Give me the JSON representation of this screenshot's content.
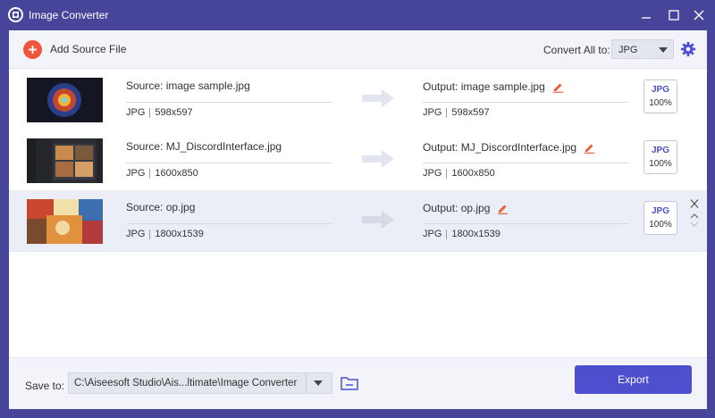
{
  "app": {
    "title": "Image Converter"
  },
  "toolbar": {
    "add_label": "Add Source File",
    "convert_all_label": "Convert All to:",
    "convert_all_value": "JPG"
  },
  "files": [
    {
      "source": "Source: image sample.jpg",
      "src_format": "JPG",
      "src_dims": "598x597",
      "output": "Output: image sample.jpg",
      "out_format": "JPG",
      "out_dims": "598x597",
      "fmt_type": "JPG",
      "fmt_quality": "100%"
    },
    {
      "source": "Source: MJ_DiscordInterface.jpg",
      "src_format": "JPG",
      "src_dims": "1600x850",
      "output": "Output: MJ_DiscordInterface.jpg",
      "out_format": "JPG",
      "out_dims": "1600x850",
      "fmt_type": "JPG",
      "fmt_quality": "100%"
    },
    {
      "source": "Source: op.jpg",
      "src_format": "JPG",
      "src_dims": "1800x1539",
      "output": "Output: op.jpg",
      "out_format": "JPG",
      "out_dims": "1800x1539",
      "fmt_type": "JPG",
      "fmt_quality": "100%"
    }
  ],
  "bottom": {
    "save_label": "Save to:",
    "save_path": "C:\\Aiseesoft Studio\\Ais...ltimate\\Image Converter",
    "export_label": "Export"
  },
  "icons": {
    "add": "plus-icon",
    "settings": "gear-icon",
    "edit": "pencil-icon",
    "arrow": "arrow-right-icon",
    "folder": "folder-icon",
    "close": "close-icon"
  },
  "colors": {
    "titlebar": "#47459a",
    "accent": "#4d4fcf",
    "add_button": "#f0553c",
    "edit_icon": "#e8603a",
    "format_text": "#4b4ec2"
  }
}
